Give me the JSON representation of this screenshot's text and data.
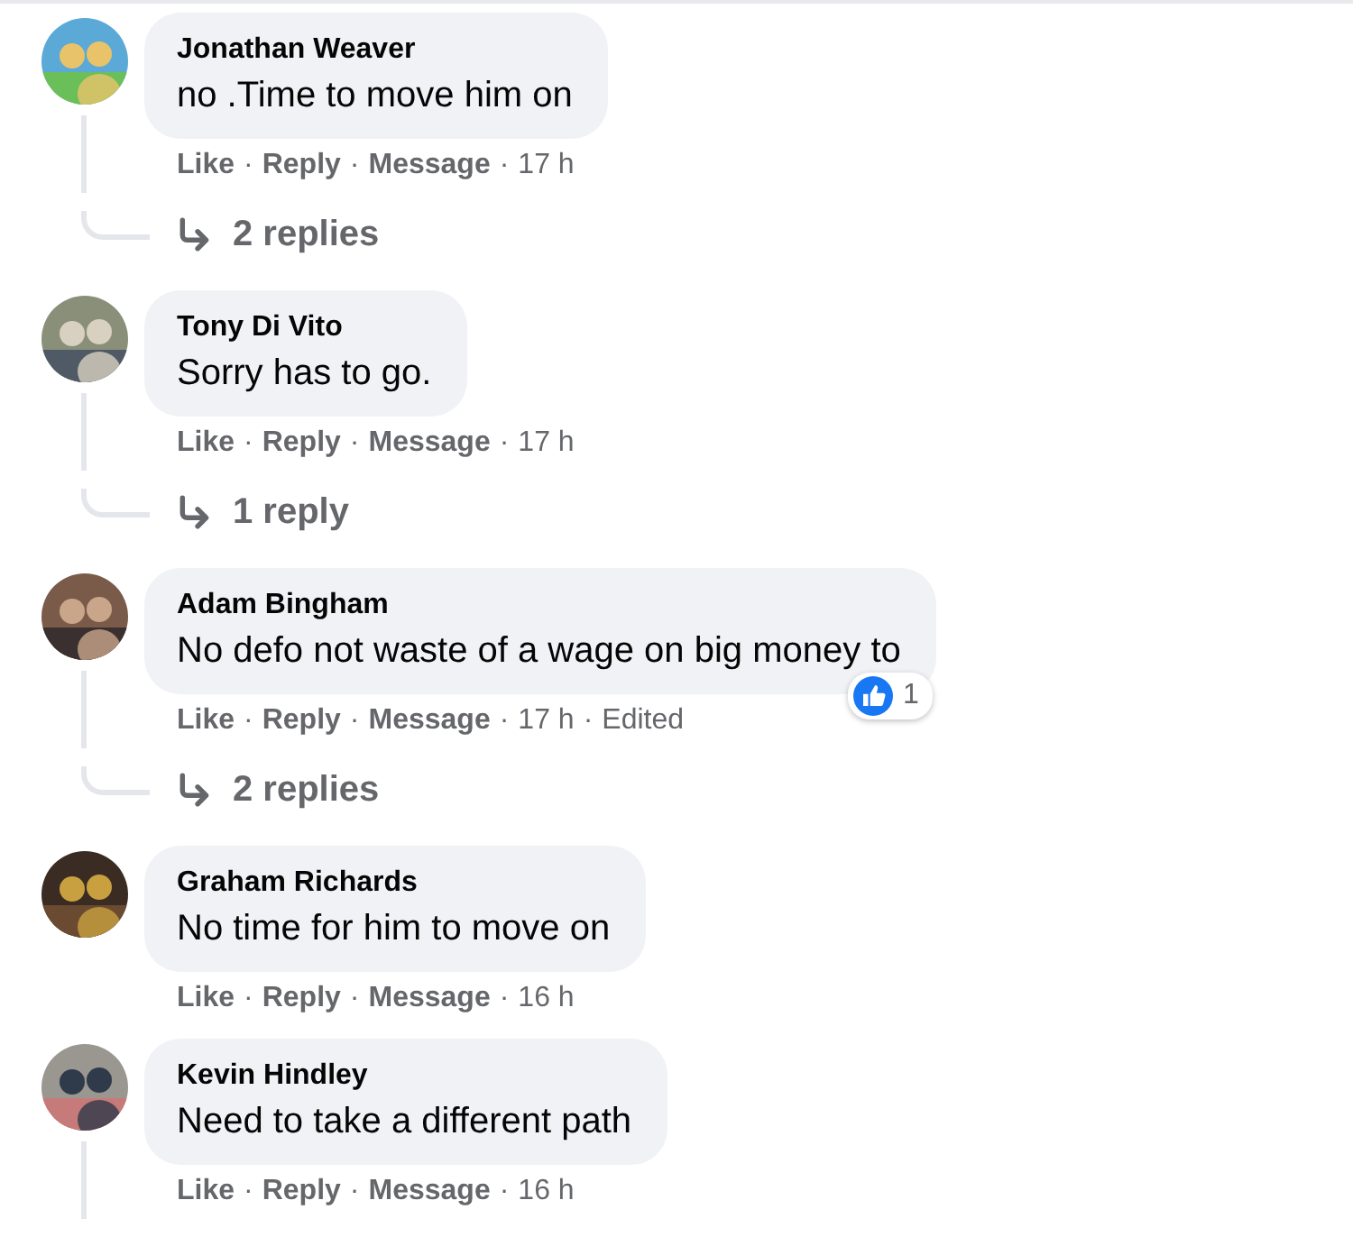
{
  "comments": [
    {
      "author": "Jonathan Weaver",
      "text": "no .Time to move him on",
      "meta": [
        {
          "kind": "link",
          "text": "Like"
        },
        {
          "kind": "dot",
          "text": "·"
        },
        {
          "kind": "link",
          "text": "Reply"
        },
        {
          "kind": "dot",
          "text": "·"
        },
        {
          "kind": "link",
          "text": "Message"
        },
        {
          "kind": "dot",
          "text": "·"
        },
        {
          "kind": "time",
          "text": "17 h"
        }
      ],
      "replies": "2 replies",
      "thread": true
    },
    {
      "author": "Tony Di Vito",
      "text": "Sorry has to go.",
      "meta": [
        {
          "kind": "link",
          "text": "Like"
        },
        {
          "kind": "dot",
          "text": "·"
        },
        {
          "kind": "link",
          "text": "Reply"
        },
        {
          "kind": "dot",
          "text": "·"
        },
        {
          "kind": "link",
          "text": "Message"
        },
        {
          "kind": "dot",
          "text": "·"
        },
        {
          "kind": "time",
          "text": "17 h"
        }
      ],
      "replies": "1 reply",
      "thread": true
    },
    {
      "author": "Adam Bingham",
      "text": "No defo not waste of a wage on big money to",
      "meta": [
        {
          "kind": "link",
          "text": "Like"
        },
        {
          "kind": "dot",
          "text": "·"
        },
        {
          "kind": "link",
          "text": "Reply"
        },
        {
          "kind": "dot",
          "text": "·"
        },
        {
          "kind": "link",
          "text": "Message"
        },
        {
          "kind": "dot",
          "text": "·"
        },
        {
          "kind": "time",
          "text": "17 h"
        },
        {
          "kind": "dot",
          "text": "·"
        },
        {
          "kind": "edited",
          "text": "Edited"
        }
      ],
      "reaction_count": "1",
      "replies": "2 replies",
      "thread": true
    },
    {
      "author": "Graham Richards",
      "text": "No time for him to move on",
      "meta": [
        {
          "kind": "link",
          "text": "Like"
        },
        {
          "kind": "dot",
          "text": "·"
        },
        {
          "kind": "link",
          "text": "Reply"
        },
        {
          "kind": "dot",
          "text": "·"
        },
        {
          "kind": "link",
          "text": "Message"
        },
        {
          "kind": "dot",
          "text": "·"
        },
        {
          "kind": "time",
          "text": "16 h"
        }
      ],
      "thread": false
    },
    {
      "author": "Kevin Hindley",
      "text": "Need to take a different path",
      "meta": [
        {
          "kind": "link",
          "text": "Like"
        },
        {
          "kind": "dot",
          "text": "·"
        },
        {
          "kind": "link",
          "text": "Reply"
        },
        {
          "kind": "dot",
          "text": "·"
        },
        {
          "kind": "link",
          "text": "Message"
        },
        {
          "kind": "dot",
          "text": "·"
        },
        {
          "kind": "time",
          "text": "16 h"
        }
      ],
      "thread": true
    }
  ]
}
